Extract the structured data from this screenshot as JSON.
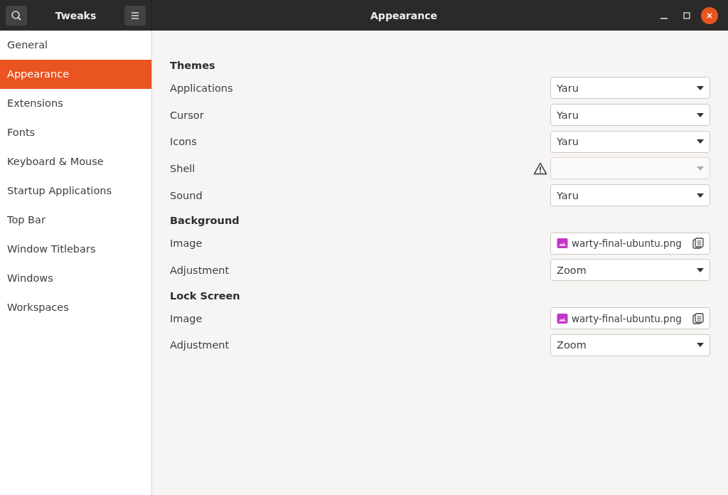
{
  "window": {
    "app_title": "Tweaks",
    "title": "Appearance"
  },
  "sidebar": {
    "items": [
      {
        "label": "General",
        "selected": false
      },
      {
        "label": "Appearance",
        "selected": true
      },
      {
        "label": "Extensions",
        "selected": false
      },
      {
        "label": "Fonts",
        "selected": false
      },
      {
        "label": "Keyboard & Mouse",
        "selected": false
      },
      {
        "label": "Startup Applications",
        "selected": false
      },
      {
        "label": "Top Bar",
        "selected": false
      },
      {
        "label": "Window Titlebars",
        "selected": false
      },
      {
        "label": "Windows",
        "selected": false
      },
      {
        "label": "Workspaces",
        "selected": false
      }
    ]
  },
  "sections": [
    {
      "title": "Themes",
      "rows": [
        {
          "kind": "combo",
          "label": "Applications",
          "value": "Yaru",
          "disabled": false,
          "warning": false
        },
        {
          "kind": "combo",
          "label": "Cursor",
          "value": "Yaru",
          "disabled": false,
          "warning": false
        },
        {
          "kind": "combo",
          "label": "Icons",
          "value": "Yaru",
          "disabled": false,
          "warning": false
        },
        {
          "kind": "combo",
          "label": "Shell",
          "disabled": true,
          "warning": true
        },
        {
          "kind": "combo",
          "label": "Sound",
          "value": "Yaru",
          "disabled": false,
          "warning": false
        }
      ]
    },
    {
      "title": "Background",
      "rows": [
        {
          "kind": "file",
          "label": "Image",
          "value": "warty-final-ubuntu.png",
          "disabled": false,
          "warning": false
        },
        {
          "kind": "combo",
          "label": "Adjustment",
          "value": "Zoom",
          "disabled": false,
          "warning": false
        }
      ]
    },
    {
      "title": "Lock Screen",
      "rows": [
        {
          "kind": "file",
          "label": "Image",
          "value": "warty-final-ubuntu.png",
          "disabled": false,
          "warning": false
        },
        {
          "kind": "combo",
          "label": "Adjustment",
          "value": "Zoom",
          "disabled": false,
          "warning": false
        }
      ]
    }
  ]
}
